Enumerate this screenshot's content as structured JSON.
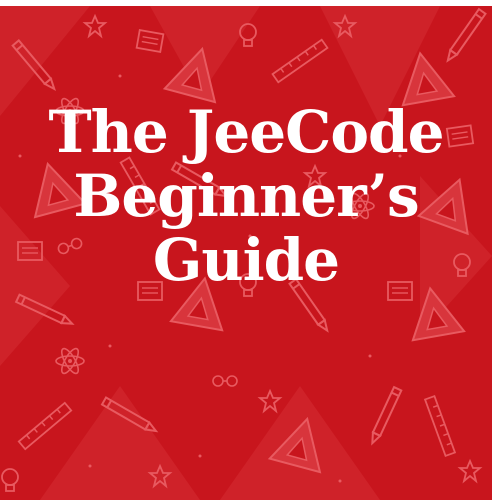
{
  "cover": {
    "background_color": "#c8151d",
    "pattern_color": "#e8545a",
    "pattern_icons": [
      "pencil-icon",
      "triangle-ruler-icon",
      "star-icon",
      "lightbulb-icon",
      "atom-icon",
      "magnet-icon",
      "notebook-icon",
      "ruler-icon",
      "eyeglasses-icon"
    ],
    "title_lines": [
      "The JeeCode",
      "Beginner’s",
      "Guide"
    ],
    "text_color": "#ffffff"
  }
}
